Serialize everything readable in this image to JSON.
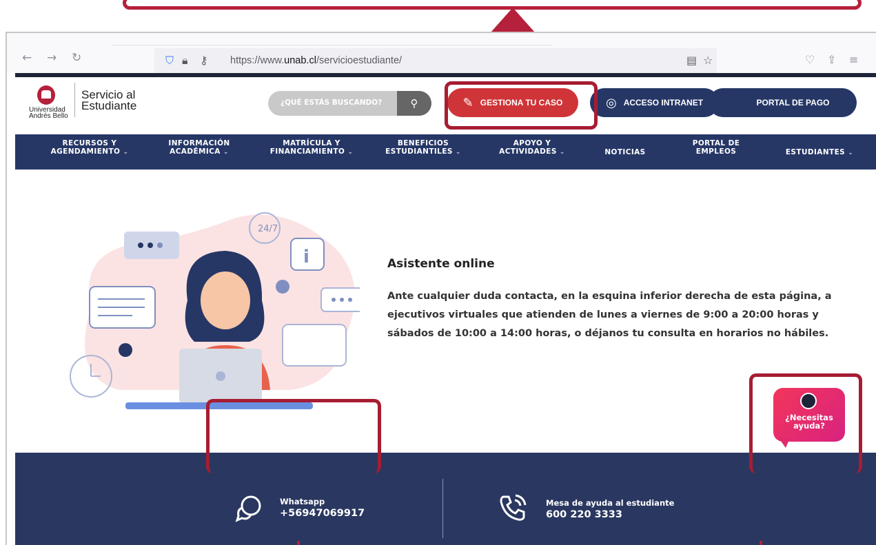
{
  "browser": {
    "url_prefix": "https://www.",
    "url_domain": "unab.cl",
    "url_path": "/servicioestudiante/",
    "back_icon": "arrow-left-icon",
    "forward_icon": "arrow-right-icon",
    "reload_icon": "reload-icon"
  },
  "header": {
    "logo_university": "Universidad Andrés Bello",
    "logo_title_line1": "Servicio al",
    "logo_title_line2": "Estudiante",
    "search_placeholder": "¿QUÉ ESTÁS BUSCANDO?",
    "buttons": {
      "gestiona": "GESTIONA TU CASO",
      "intranet": "ACCESO INTRANET",
      "pago": "PORTAL DE PAGO"
    }
  },
  "nav": {
    "items": [
      {
        "line1": "RECURSOS Y",
        "line2": "AGENDAMIENTO"
      },
      {
        "line1": "INFORMACIÓN",
        "line2": "ACADÉMICA"
      },
      {
        "line1": "MATRÍCULA Y",
        "line2": "FINANCIAMIENTO"
      },
      {
        "line1": "BENEFICIOS",
        "line2": "ESTUDIANTILES"
      },
      {
        "line1": "APOYO Y",
        "line2": "ACTIVIDADES"
      },
      {
        "line1": "NOTICIAS",
        "line2": ""
      },
      {
        "line1": "PORTAL DE",
        "line2": "EMPLEOS"
      },
      {
        "line1": "ESTUDIANTES",
        "line2": ""
      }
    ]
  },
  "content": {
    "title": "Asistente online",
    "body": "Ante cualquier duda contacta, en la esquina inferior derecha de esta página, a ejecutivos virtuales que atienden de lunes a viernes de 9:00 a 20:00 horas y sábados de 10:00 a 14:00 horas, o déjanos tu consulta en horarios no hábiles.",
    "badge_247": "24/7"
  },
  "footer": {
    "whatsapp_label": "Whatsapp",
    "whatsapp_value": "+56947069917",
    "mesa_label": "Mesa de ayuda al estudiante",
    "mesa_value": "600 220 3333",
    "help_text_line1": "¿Necesitas",
    "help_text_line2": "ayuda?"
  },
  "colors": {
    "navy": "#263766",
    "red": "#cf3438",
    "annotation": "#b5203a"
  }
}
